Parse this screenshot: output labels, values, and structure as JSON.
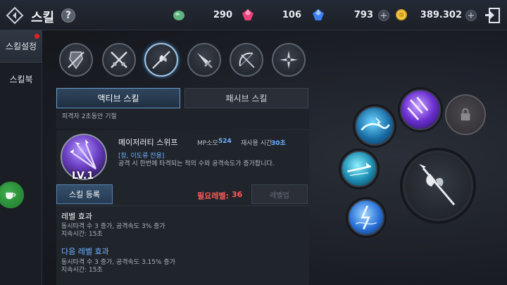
{
  "header": {
    "title": "스킬",
    "help_label": "?",
    "resources": [
      {
        "name": "green-gem",
        "value": "290"
      },
      {
        "name": "red-gem",
        "value": "106"
      },
      {
        "name": "blue-gem",
        "value": "793"
      },
      {
        "name": "gold-coin",
        "value": "389.302"
      }
    ],
    "plus_label": "+"
  },
  "sidebar": {
    "items": [
      {
        "label": "스킬설정",
        "active": true
      },
      {
        "label": "스킬북",
        "active": false
      }
    ]
  },
  "weapons": [
    "shield-icon",
    "dual-swords-icon",
    "halberd-icon",
    "dagger-icon",
    "bow-icon",
    "shuriken-icon"
  ],
  "tabs": {
    "active": "액티브 스킬",
    "passive": "패시브 스킬"
  },
  "panel": {
    "prev_text": "피격자 2초동안 기절",
    "skill": {
      "level": "LV.1",
      "name": "메이저러티 스위프",
      "mp_label": "MP소모",
      "mp_value": "524",
      "cooldown_label": "재사용 시간",
      "cooldown_value": "30초",
      "tag": "[창, 이도류 전용]",
      "description": "공격 시 한번에 타격되는 적의 수와 공격속도가 증가합니다."
    },
    "register_button": "스킬 등록",
    "required_level_label": "필요레벨:",
    "required_level_value": "36",
    "level_up_button": "레벨업",
    "level_effect": {
      "title": "레벨 효과",
      "lines": [
        "동시타격 수 3 증가, 공격속도 3% 증가",
        "지속시간: 15초"
      ]
    },
    "next_level_effect": {
      "title": "다음 레벨 효과",
      "lines": [
        "동시타격 수 3 증가, 공격속도 3.15% 증가",
        "지속시간: 15초"
      ]
    }
  },
  "colors": {
    "accent_blue": "#6fb2ff",
    "required_red": "#ff5b5b"
  }
}
